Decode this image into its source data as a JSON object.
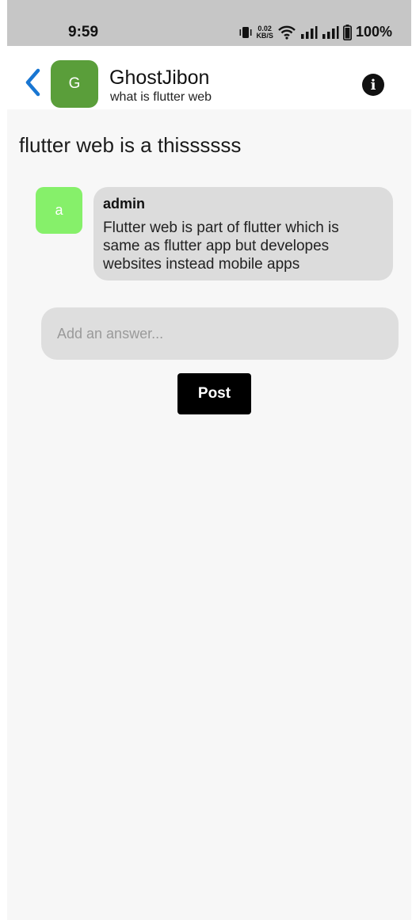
{
  "status_bar": {
    "time": "9:59",
    "net_speed_value": "0.02",
    "net_speed_unit": "KB/S",
    "battery": "100%",
    "icons": [
      "vibrate-icon",
      "wifi-icon",
      "signal-icon",
      "signal-icon",
      "battery-icon"
    ]
  },
  "header": {
    "back_icon": "chevron-left-icon",
    "avatar_letter": "G",
    "avatar_color": "#5a9e3a",
    "title": "GhostJibon",
    "subtitle": "what is flutter web",
    "info_icon": "info-icon",
    "info_glyph": "i",
    "accent_color": "#1976d2"
  },
  "question": {
    "title": "flutter web is a thissssss"
  },
  "answers": [
    {
      "avatar_letter": "a",
      "avatar_color": "#86f06a",
      "author": "admin",
      "text": "Flutter web is part of flutter which is same as flutter app but developes websites instead mobile apps"
    }
  ],
  "composer": {
    "placeholder": "Add an answer...",
    "value": "",
    "post_label": "Post"
  }
}
